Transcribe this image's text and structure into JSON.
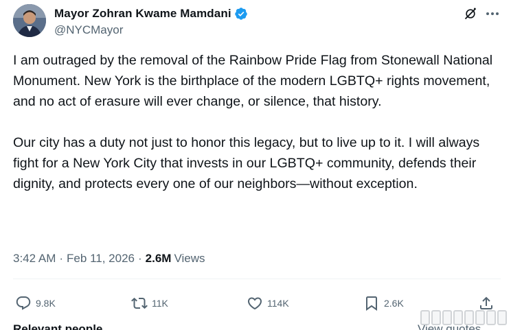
{
  "author": {
    "display_name": "Mayor Zohran Kwame Mamdani",
    "handle": "@NYCMayor",
    "verified_color": "#1d9bf0"
  },
  "post": {
    "paragraphs": [
      "I am outraged by the removal of the Rainbow Pride Flag from Stonewall National Monument. New York is the birthplace of the modern LGBTQ+ rights movement, and no act of erasure will ever change, or silence, that history.",
      "Our city has a duty not just to honor this legacy, but to live up to it. I will always fight for a New York City that invests in our LGBTQ+ community, defends their dignity, and protects every one of our neighbors—without exception."
    ],
    "time": "3:42 AM",
    "separator": "·",
    "date": "Feb 11, 2026",
    "views_count": "2.6M",
    "views_label": "Views"
  },
  "actions": {
    "replies": "9.8K",
    "reposts": "11K",
    "likes": "114K",
    "bookmarks": "2.6K"
  },
  "footer": {
    "left_label": "Relevant people",
    "right_label": "View quotes"
  },
  "icons": {
    "grok": "grok-icon",
    "more": "more-icon",
    "reply": "reply-icon",
    "repost": "repost-icon",
    "like": "heart-icon",
    "bookmark": "bookmark-icon",
    "share": "share-icon"
  }
}
